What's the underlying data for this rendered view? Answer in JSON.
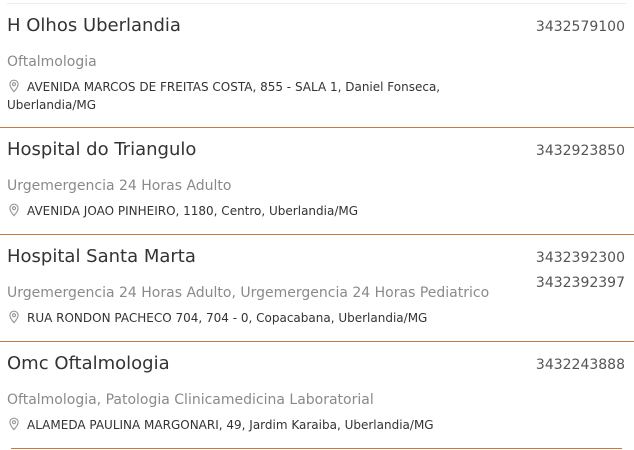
{
  "colors": {
    "divider": "#c77a3f",
    "name": "#333333",
    "specialty": "#8a8a8a",
    "phone": "#555555",
    "icon": "#999999"
  },
  "icons": {
    "address": "map-pin-icon"
  },
  "entries": [
    {
      "name": "H Olhos Uberlandia",
      "phones": [
        "3432579100"
      ],
      "specialty": "Oftalmologia",
      "address": "AVENIDA MARCOS DE FREITAS COSTA, 855 - SALA 1, Daniel Fonseca, Uberlandia/MG"
    },
    {
      "name": "Hospital do Triangulo",
      "phones": [
        "3432923850"
      ],
      "specialty": "Urgemergencia 24 Horas Adulto",
      "address": "AVENIDA JOAO PINHEIRO, 1180, Centro, Uberlandia/MG"
    },
    {
      "name": "Hospital Santa Marta",
      "phones": [
        "3432392300",
        "3432392397"
      ],
      "specialty": "Urgemergencia 24 Horas Adulto, Urgemergencia 24 Horas Pediatrico",
      "address": "RUA RONDON PACHECO 704, 704 - 0, Copacabana, Uberlandia/MG"
    },
    {
      "name": "Omc Oftalmologia",
      "phones": [
        "3432243888"
      ],
      "specialty": "Oftalmologia, Patologia Clinicamedicina Laboratorial",
      "address": "ALAMEDA PAULINA MARGONARI, 49, Jardim Karaiba, Uberlandia/MG"
    }
  ]
}
